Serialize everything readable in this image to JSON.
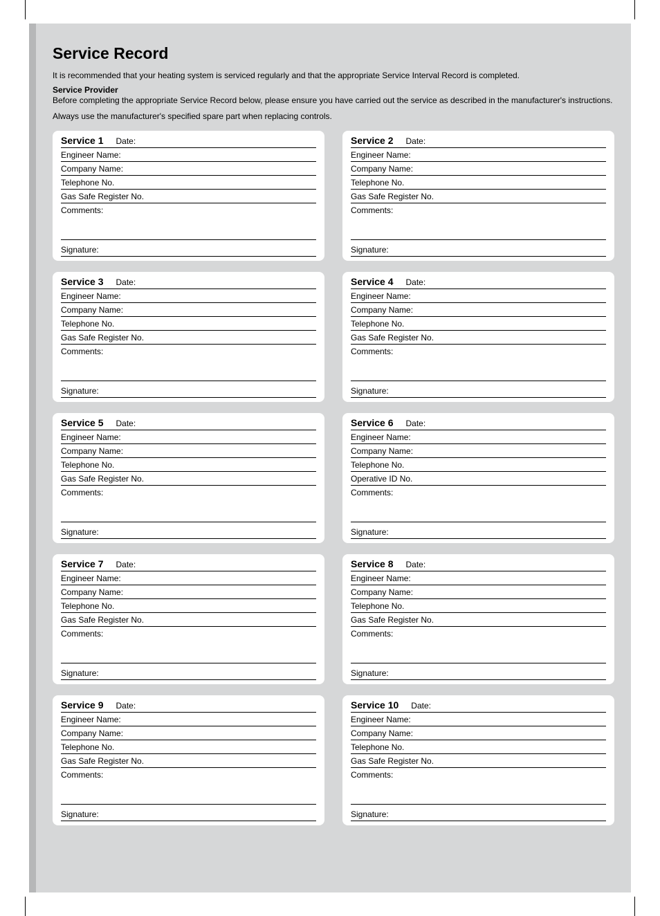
{
  "title": "Service Record",
  "intro": "It is recommended that your heating system is serviced regularly and that the appropriate Service Interval Record is completed.",
  "provider_heading": "Service Provider",
  "provider_text": "Before completing the appropriate Service Record below, please ensure you have carried out the service as described in the manufacturer's instructions.",
  "spare_note": "Always use the manufacturer's specified spare part when replacing controls.",
  "field_labels": {
    "date": "Date:",
    "engineer": "Engineer Name:",
    "company": "Company Name:",
    "telephone": "Telephone No.",
    "gassafe": "Gas Safe Register No.",
    "operative": "Operative ID No.",
    "comments": "Comments:",
    "signature": "Signature:"
  },
  "services": [
    {
      "title": "Service 1",
      "reg_field": "gassafe"
    },
    {
      "title": "Service 2",
      "reg_field": "gassafe"
    },
    {
      "title": "Service 3",
      "reg_field": "gassafe"
    },
    {
      "title": "Service 4",
      "reg_field": "gassafe"
    },
    {
      "title": "Service 5",
      "reg_field": "gassafe"
    },
    {
      "title": "Service 6",
      "reg_field": "operative"
    },
    {
      "title": "Service 7",
      "reg_field": "gassafe"
    },
    {
      "title": "Service 8",
      "reg_field": "gassafe"
    },
    {
      "title": "Service 9",
      "reg_field": "gassafe"
    },
    {
      "title": "Service 10",
      "reg_field": "gassafe"
    }
  ]
}
